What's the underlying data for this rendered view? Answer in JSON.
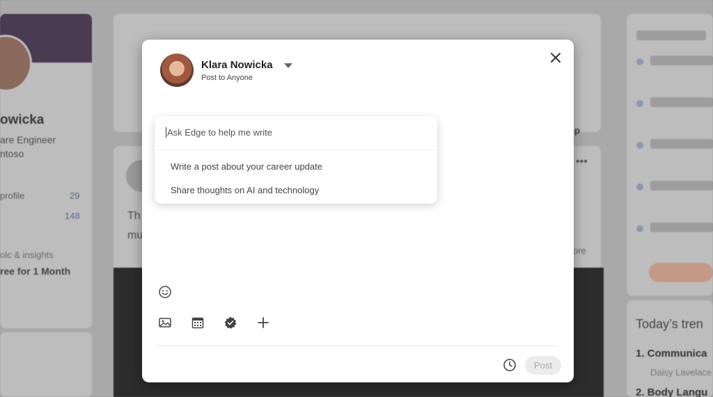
{
  "background": {
    "left_name": "owicka",
    "left_title": "are Engineer",
    "left_company": "ntoso",
    "left_profile_label": "profile",
    "left_profile_count": "29",
    "left_count2": "148",
    "left_tools_label": "olc & insights",
    "left_free_label": "ree for 1 Month",
    "center_sort_fragment": "op",
    "feed_text_1": "Th",
    "feed_text_2": "mu",
    "feed_more": "ore",
    "right_heading": "Today’s tren",
    "right_item1": "1. Communica",
    "right_item1_sub": "Daisy Lavelace",
    "right_item2": "2. Body Langu"
  },
  "modal": {
    "author_name": "Klara Nowicka",
    "audience": "Post to Anyone",
    "edge_placeholder": "Ask Edge to help me write",
    "suggestions": [
      "Write a post about your career update",
      "Share thoughts on AI and technology"
    ],
    "post_label": "Post"
  },
  "icons": {
    "close": "close-icon",
    "emoji": "emoji-icon",
    "image": "image-icon",
    "calendar": "calendar-icon",
    "badge": "badge-icon",
    "plus": "plus-icon",
    "clock": "clock-icon",
    "cursor": "mouse-cursor-icon"
  }
}
